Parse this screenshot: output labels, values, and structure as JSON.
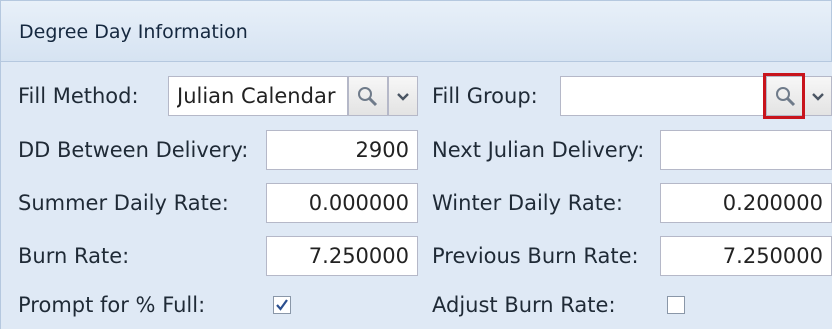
{
  "panel": {
    "title": "Degree Day Information"
  },
  "fields": {
    "fill_method": {
      "label": "Fill Method:",
      "value": "Julian Calendar"
    },
    "fill_group": {
      "label": "Fill Group:",
      "value": ""
    },
    "dd_between_delivery": {
      "label": "DD Between Delivery:",
      "value": "2900"
    },
    "next_julian_delivery": {
      "label": "Next Julian Delivery:",
      "value": ""
    },
    "summer_daily_rate": {
      "label": "Summer Daily Rate:",
      "value": "0.000000"
    },
    "winter_daily_rate": {
      "label": "Winter Daily Rate:",
      "value": "0.200000"
    },
    "burn_rate": {
      "label": "Burn Rate:",
      "value": "7.250000"
    },
    "previous_burn_rate": {
      "label": "Previous Burn Rate:",
      "value": "7.250000"
    },
    "prompt_for_full": {
      "label": "Prompt for % Full:",
      "checked": true
    },
    "adjust_burn_rate": {
      "label": "Adjust Burn Rate:",
      "checked": false
    }
  },
  "icons": {
    "search": "magnifier-icon",
    "dropdown": "chevron-down-icon",
    "check": "checkmark-icon"
  },
  "colors": {
    "highlight": "#c8141c",
    "panel_bg": "#dfe9f5",
    "header_bg": "#d6e3f2"
  }
}
